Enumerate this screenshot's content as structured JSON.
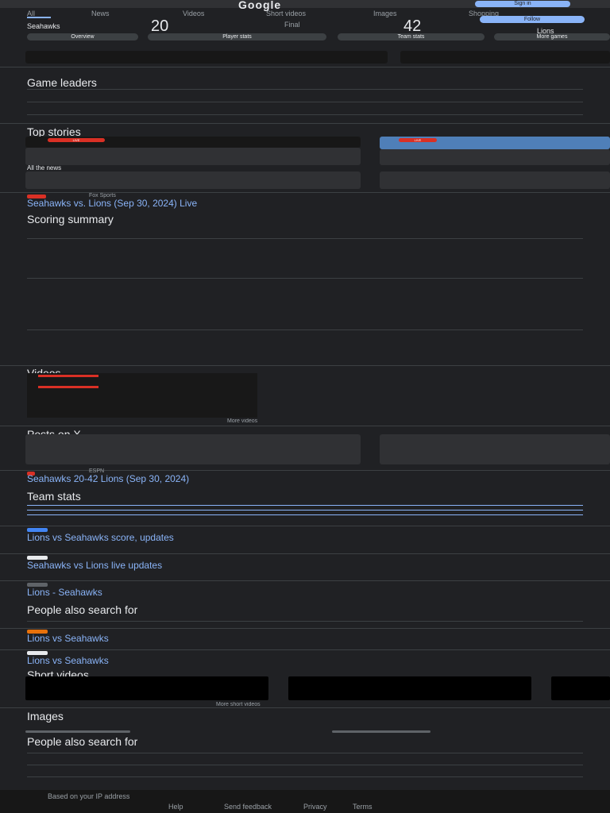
{
  "header": {
    "logo": "Google",
    "sign_in": "Sign in"
  },
  "tabs": [
    "All",
    "News",
    "Videos",
    "Short videos",
    "Images",
    "Shopping"
  ],
  "scoreboard": {
    "team_left": "Seahawks",
    "score_left": "20",
    "status": "Final",
    "team_right": "Lions",
    "score_right": "42",
    "follow": "Follow"
  },
  "pills": [
    "Overview",
    "Player stats",
    "Team stats",
    "More games"
  ],
  "game_leaders": {
    "title": "Game leaders"
  },
  "top_stories": {
    "title": "Top stories",
    "live": "LIVE",
    "all_news": "All the news"
  },
  "result_1": {
    "source": "Fox Sports",
    "title": "Seahawks vs. Lions (Sep 30, 2024) Live"
  },
  "scoring": {
    "title": "Scoring summary"
  },
  "videos": {
    "title": "Videos",
    "more": "More videos"
  },
  "posts": {
    "title": "Posts on X"
  },
  "result_2": {
    "source": "ESPN",
    "title": "Seahawks 20-42 Lions (Sep 30, 2024)"
  },
  "team_stats": {
    "title": "Team stats"
  },
  "result_3": {
    "title": "Lions vs Seahawks score, updates"
  },
  "result_4": {
    "title": "Seahawks vs Lions live updates"
  },
  "result_5": {
    "title": "Lions - Seahawks"
  },
  "pals_1": {
    "title": "People also search for"
  },
  "result_6": {
    "title": "Lions vs Seahawks"
  },
  "result_7": {
    "title": "Lions vs Seahawks"
  },
  "short_videos": {
    "title": "Short videos",
    "more": "More short videos"
  },
  "images": {
    "title": "Images"
  },
  "pals_2": {
    "title": "People also search for"
  },
  "footer": {
    "location": "Based on your IP address",
    "links": [
      "Help",
      "Send feedback",
      "Privacy",
      "Terms"
    ]
  },
  "colors": {
    "bg": "#202124",
    "link": "#8ab4f8",
    "live": "#d93025",
    "accent": "#4285f4"
  }
}
